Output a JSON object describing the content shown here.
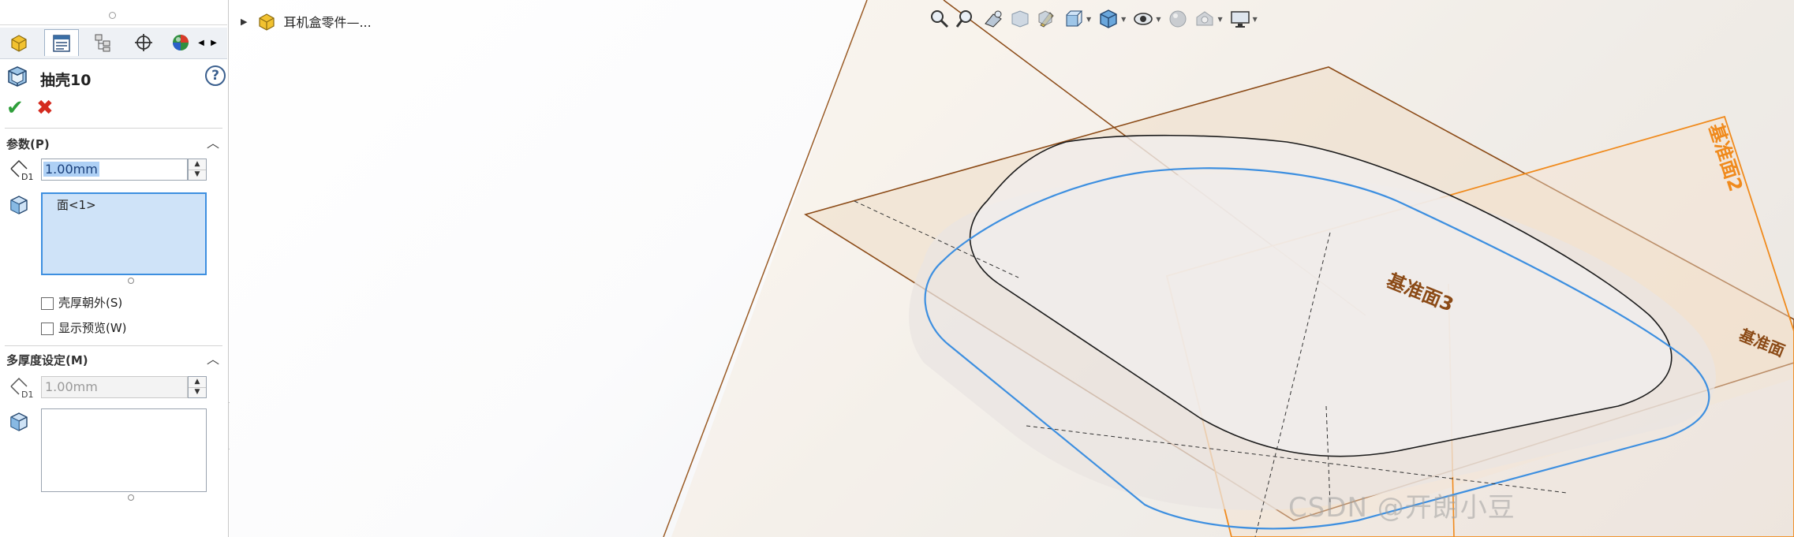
{
  "panel": {
    "title": "抽壳10",
    "help_label": "?",
    "ok_glyph": "✔",
    "cancel_glyph": "✖",
    "tabs": [
      {
        "name": "featuremanager-tab",
        "icon": "part-icon"
      },
      {
        "name": "propertymanager-tab",
        "icon": "property-list-icon"
      },
      {
        "name": "configurationmanager-tab",
        "icon": "config-tree-icon"
      },
      {
        "name": "dimxpert-tab",
        "icon": "crosshair-icon"
      },
      {
        "name": "appearance-tab",
        "icon": "appearance-ball-icon"
      }
    ],
    "params": {
      "header": "参数(P)",
      "thickness_value": "1.00mm",
      "faces_item": "面<1>",
      "shell_outward_label": "壳厚朝外(S)",
      "show_preview_label": "显示预览(W)"
    },
    "multi": {
      "header": "多厚度设定(M)",
      "thickness_value": "1.00mm"
    }
  },
  "tree": {
    "part_name": "耳机盒零件—..."
  },
  "planes": {
    "plane2": "基准面2",
    "plane3": "基准面3",
    "plane1_partial": "基准面"
  },
  "watermark": "CSDN @开朗小豆",
  "colors": {
    "accent_blue": "#4a90d9",
    "ok_green": "#2e9e3a",
    "cancel_red": "#d42a1e",
    "plane_brown": "#8b4a16",
    "plane_orange": "#f08a1c",
    "selection_blue": "#3d8fe0",
    "multi_pink": "#f27ab8"
  }
}
